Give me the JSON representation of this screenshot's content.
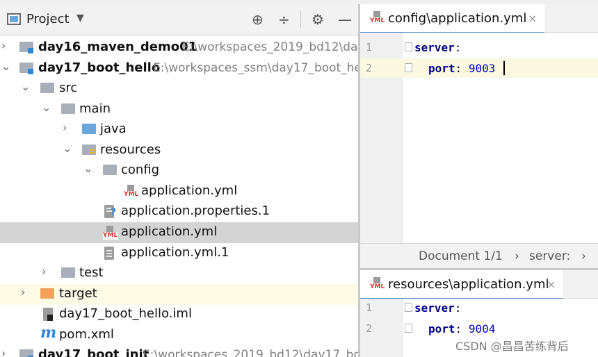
{
  "project_panel": {
    "title": "Project",
    "tree": [
      {
        "label": "day16_maven_demo01",
        "path": "E:\\workspaces_2019_bd12\\da"
      },
      {
        "label": "day17_boot_hello",
        "path": "E:\\workspaces_ssm\\day17_boot_he"
      },
      {
        "label": "src"
      },
      {
        "label": "main"
      },
      {
        "label": "java"
      },
      {
        "label": "resources"
      },
      {
        "label": "config"
      },
      {
        "label": "application.yml"
      },
      {
        "label": "application.properties.1"
      },
      {
        "label": "application.yml"
      },
      {
        "label": "application.yml.1"
      },
      {
        "label": "test"
      },
      {
        "label": "target"
      },
      {
        "label": "day17_boot_hello.iml"
      },
      {
        "label": "pom.xml"
      },
      {
        "label": "day17_boot_init",
        "path": "E:\\workspaces_2019_bd12\\day17_bo"
      }
    ]
  },
  "editor_top": {
    "tab_label": "config\\application.yml",
    "lines": [
      {
        "num": "1",
        "key": "server",
        "colon": ":",
        "value": ""
      },
      {
        "num": "2",
        "key": "port",
        "colon": ":",
        "value": "9003"
      }
    ],
    "breadcrumb": {
      "doc": "Document 1/1",
      "node": "server:"
    }
  },
  "editor_bottom": {
    "tab_label": "resources\\application.yml",
    "lines": [
      {
        "num": "1",
        "key": "server",
        "colon": ":",
        "value": ""
      },
      {
        "num": "2",
        "key": "port",
        "colon": ":",
        "value": "9004"
      }
    ]
  },
  "icons": {
    "yml_badge": "YML",
    "maven": "m",
    "arrow_right": "›",
    "arrow_down": "⌄",
    "close": "×"
  },
  "watermark": "CSDN @昌昌苦练背后"
}
